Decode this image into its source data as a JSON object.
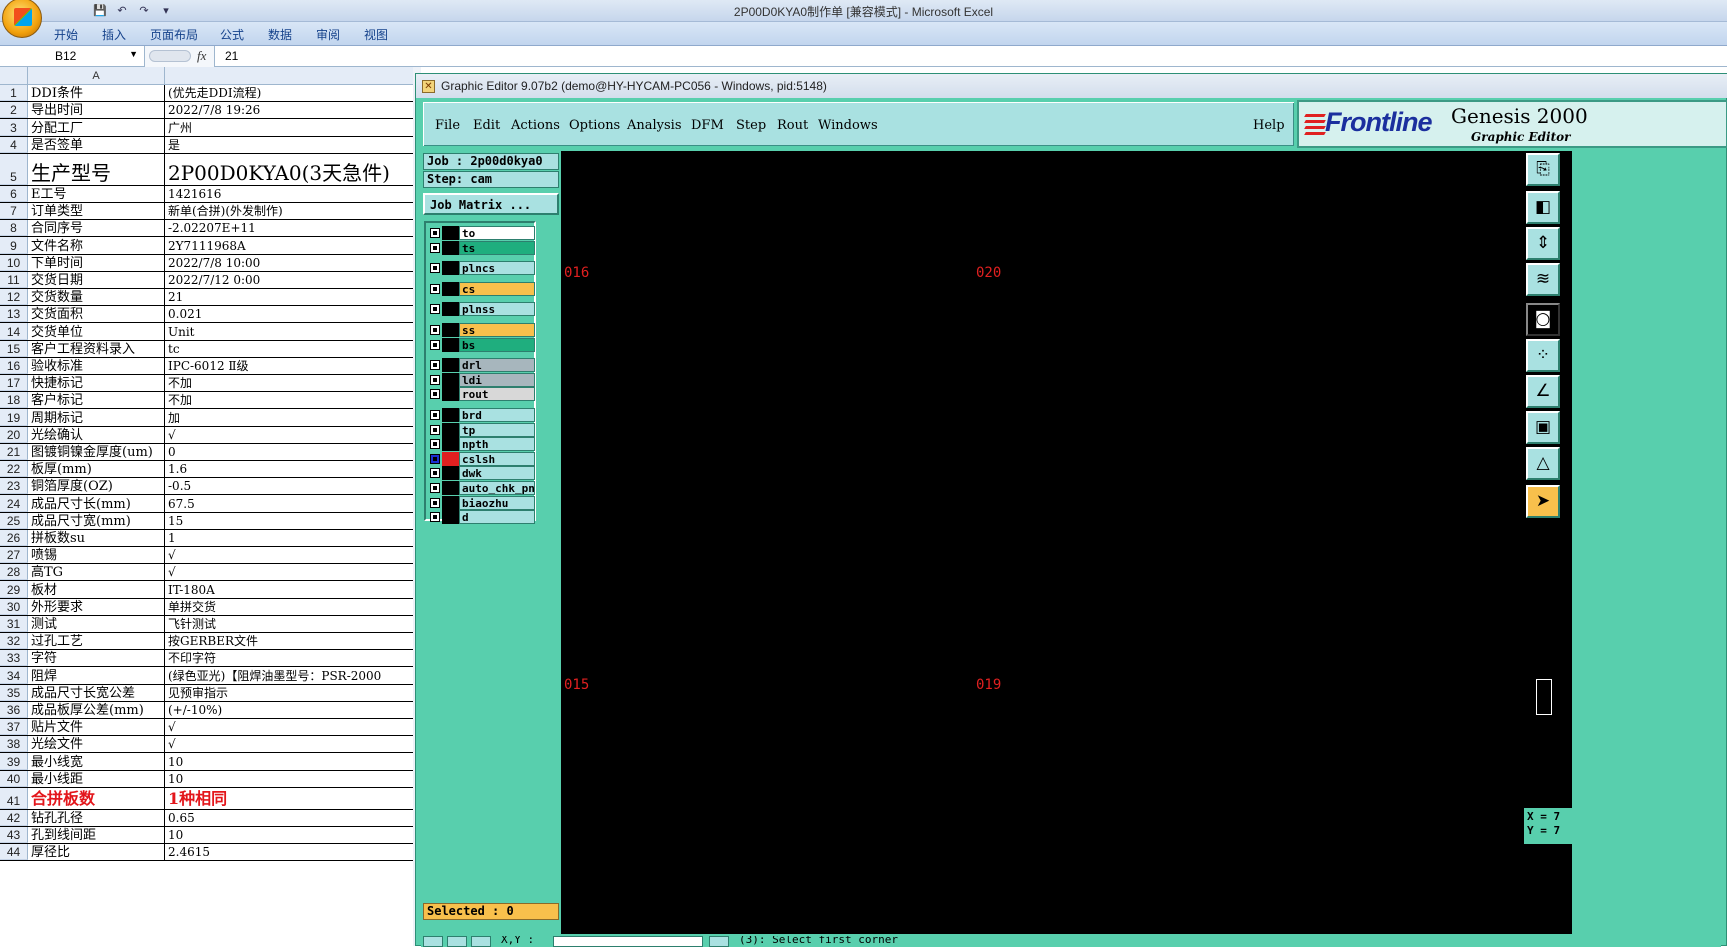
{
  "excel": {
    "window_title": "2P00D0KYA0制作单  [兼容模式] - Microsoft Excel",
    "ribbon_tabs": [
      "开始",
      "插入",
      "页面布局",
      "公式",
      "数据",
      "审阅",
      "视图"
    ],
    "name_box": "B12",
    "formula_fx": "fx",
    "formula_value": "21",
    "column_header_a": "A",
    "rows": [
      {
        "n": "1",
        "a": "DDI条件",
        "b": "(优先走DDI流程)"
      },
      {
        "n": "2",
        "a": "导出时间",
        "b": "2022/7/8 19:26"
      },
      {
        "n": "3",
        "a": "分配工厂",
        "b": "广州"
      },
      {
        "n": "4",
        "a": "是否签单",
        "b": "是"
      },
      {
        "n": "5",
        "a": "生产型号",
        "b": "2P00D0KYA0(3天急件)",
        "style": "big"
      },
      {
        "n": "6",
        "a": "E工号",
        "b": "1421616"
      },
      {
        "n": "7",
        "a": "订单类型",
        "b": "新单(合拼)(外发制作)"
      },
      {
        "n": "8",
        "a": "合同序号",
        "b": "-2.02207E+11"
      },
      {
        "n": "9",
        "a": "文件名称",
        "b": "2Y7111968A"
      },
      {
        "n": "10",
        "a": "下单时间",
        "b": "2022/7/8 10:00"
      },
      {
        "n": "11",
        "a": "交货日期",
        "b": "2022/7/12 0:00"
      },
      {
        "n": "12",
        "a": "交货数量",
        "b": "21"
      },
      {
        "n": "13",
        "a": "交货面积",
        "b": "0.021"
      },
      {
        "n": "14",
        "a": "交货单位",
        "b": "Unit"
      },
      {
        "n": "15",
        "a": "客户工程资料录入",
        "b": "tc"
      },
      {
        "n": "16",
        "a": "验收标准",
        "b": "IPC-6012 Ⅱ级"
      },
      {
        "n": "17",
        "a": "快捷标记",
        "b": "不加"
      },
      {
        "n": "18",
        "a": "客户标记",
        "b": "不加"
      },
      {
        "n": "19",
        "a": "周期标记",
        "b": "加"
      },
      {
        "n": "20",
        "a": "光绘确认",
        "b": "√"
      },
      {
        "n": "21",
        "a": "图镀铜镍金厚度(um)",
        "b": "0"
      },
      {
        "n": "22",
        "a": "板厚(mm)",
        "b": "1.6"
      },
      {
        "n": "23",
        "a": "铜箔厚度(OZ)",
        "b": "-0.5"
      },
      {
        "n": "24",
        "a": "成品尺寸长(mm)",
        "b": "67.5"
      },
      {
        "n": "25",
        "a": "成品尺寸宽(mm)",
        "b": "15"
      },
      {
        "n": "26",
        "a": "拼板数su",
        "b": "1"
      },
      {
        "n": "27",
        "a": "喷锡",
        "b": "√"
      },
      {
        "n": "28",
        "a": "高TG",
        "b": "√"
      },
      {
        "n": "29",
        "a": "板材",
        "b": "IT-180A"
      },
      {
        "n": "30",
        "a": "外形要求",
        "b": "单拼交货"
      },
      {
        "n": "31",
        "a": "测试",
        "b": "飞针测试"
      },
      {
        "n": "32",
        "a": "过孔工艺",
        "b": "按GERBER文件"
      },
      {
        "n": "33",
        "a": "字符",
        "b": "不印字符"
      },
      {
        "n": "34",
        "a": "阻焊",
        "b": "(绿色亚光)【阻焊油墨型号：PSR-2000"
      },
      {
        "n": "35",
        "a": "成品尺寸长宽公差",
        "b": "见预审指示"
      },
      {
        "n": "36",
        "a": "成品板厚公差(mm)",
        "b": "(+/-10%)"
      },
      {
        "n": "37",
        "a": "贴片文件",
        "b": "√"
      },
      {
        "n": "38",
        "a": "光绘文件",
        "b": "√"
      },
      {
        "n": "39",
        "a": "最小线宽",
        "b": "10"
      },
      {
        "n": "40",
        "a": "最小线距",
        "b": "10"
      },
      {
        "n": "41",
        "a": "合拼板数",
        "b": "1种相同",
        "style": "red"
      },
      {
        "n": "42",
        "a": "钻孔孔径",
        "b": "0.65"
      },
      {
        "n": "43",
        "a": "孔到线间距",
        "b": "10"
      },
      {
        "n": "44",
        "a": "厚径比",
        "b": "2.4615"
      }
    ]
  },
  "genesis": {
    "window_title": "Graphic Editor 9.07b2 (demo@HY-HYCAM-PC056 - Windows, pid:5148)",
    "menu": [
      "File",
      "Edit",
      "Actions",
      "Options",
      "Analysis",
      "DFM",
      "Step",
      "Rout",
      "Windows"
    ],
    "help": "Help",
    "brand_logo": "Frontline",
    "brand_product": "Genesis 2000",
    "brand_sub": "Graphic Editor",
    "job": "Job : 2p00d0kya0",
    "step": "Step: cam",
    "job_matrix": "Job Matrix ...",
    "layers": [
      {
        "name": "to",
        "color": "#ffffff"
      },
      {
        "name": "ts",
        "color": "#1fae7e"
      },
      {
        "name": "plncs",
        "color": "#a9e1e1"
      },
      {
        "name": "cs",
        "color": "#f8c04c"
      },
      {
        "name": "plnss",
        "color": "#a9e1e1"
      },
      {
        "name": "ss",
        "color": "#f8c04c"
      },
      {
        "name": "bs",
        "color": "#1fae7e"
      },
      {
        "name": "drl",
        "color": "#a7b6bd"
      },
      {
        "name": "ldi",
        "color": "#a7b6bd"
      },
      {
        "name": "rout",
        "color": "#d8d8d8"
      },
      {
        "name": "brd",
        "color": "#a9e1e1"
      },
      {
        "name": "tp",
        "color": "#a9e1e1"
      },
      {
        "name": "npth",
        "color": "#a9e1e1"
      },
      {
        "name": "cslsh",
        "color": "#a9e1e1"
      },
      {
        "name": "dwk",
        "color": "#a9e1e1"
      },
      {
        "name": "auto_chk_pn",
        "color": "#a9e1e1"
      },
      {
        "name": "biaozhu",
        "color": "#a9e1e1"
      },
      {
        "name": "d",
        "color": "#a9e1e1"
      }
    ],
    "selected": "Selected : 0",
    "canvas_labels": [
      "016",
      "020",
      "015",
      "019"
    ],
    "coord_x": "X = 7",
    "coord_y": "Y = 7",
    "status_prompt": "(3): Select first corner",
    "status_xy": "X,Y :"
  },
  "colors": {
    "genesis_teal": "#58cfad",
    "canvas": "#000000",
    "label_red": "#e02020",
    "excel_blue": "#15428b"
  }
}
